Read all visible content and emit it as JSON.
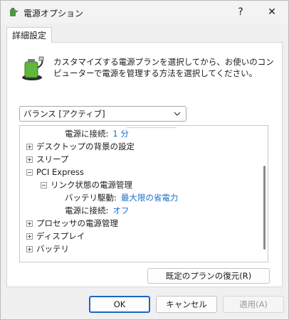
{
  "window": {
    "title": "電源オプション",
    "help_label": "?",
    "close_label": "✕"
  },
  "tab": {
    "label": "詳細設定"
  },
  "description": "カスタマイズする電源プランを選択してから、お使いのコンピューターで電源を管理する方法を選択してください。",
  "plan_dropdown": {
    "selected": "バランス [アクティブ]"
  },
  "tree": {
    "rows": [
      {
        "label": "電源に接続:",
        "value": "1 分"
      },
      {
        "label": "デスクトップの背景の設定"
      },
      {
        "label": "スリープ"
      },
      {
        "label": "PCI Express"
      },
      {
        "label": "リンク状態の電源管理"
      },
      {
        "label": "バッテリ駆動:",
        "value": "最大限の省電力"
      },
      {
        "label": "電源に接続:",
        "value": "オフ"
      },
      {
        "label": "プロセッサの電源管理"
      },
      {
        "label": "ディスプレイ"
      },
      {
        "label": "バッテリ"
      }
    ]
  },
  "buttons": {
    "restore": "既定のプランの復元(R)",
    "ok": "OK",
    "cancel": "キャンセル",
    "apply": "適用(A)"
  },
  "colors": {
    "value_link": "#1a6fcf",
    "ok_border": "#1a67c4"
  }
}
